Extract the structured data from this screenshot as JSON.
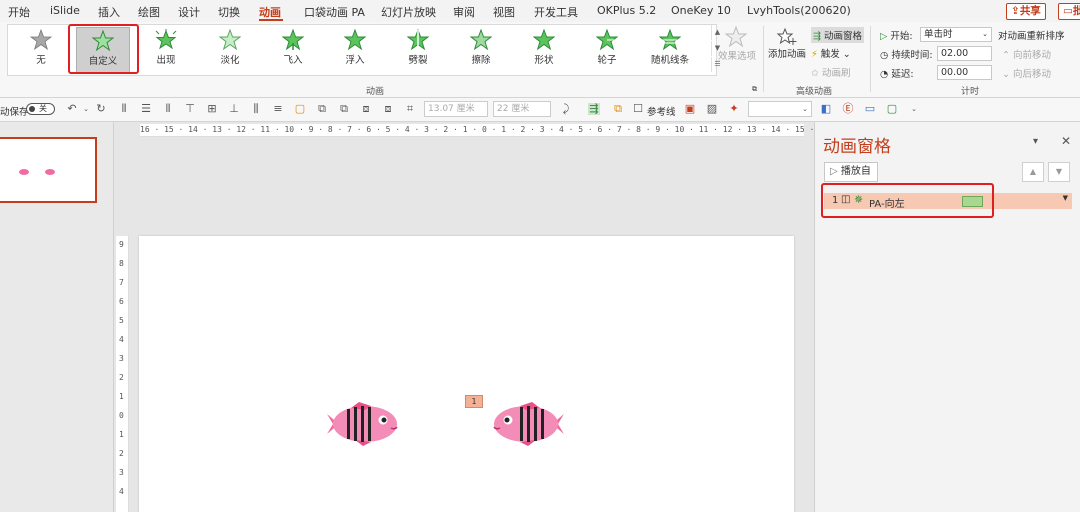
{
  "menu": {
    "tabs": [
      "开始",
      "iSlide",
      "插入",
      "绘图",
      "设计",
      "切换",
      "动画",
      "口袋动画 PA",
      "幻灯片放映",
      "审阅",
      "视图",
      "开发工具",
      "OKPlus 5.2",
      "OneKey 10",
      "LvyhTools(200620)"
    ],
    "share_label": "共享",
    "comment_label": "批"
  },
  "ribbon": {
    "animations": [
      "无",
      "自定义",
      "出现",
      "淡化",
      "飞入",
      "浮入",
      "劈裂",
      "擦除",
      "形状",
      "轮子",
      "随机线条"
    ],
    "effect_options_label": "效果选项",
    "group_animation_label": "动画",
    "add_animation_label": "添加动画",
    "animation_pane_label": "动画窗格",
    "trigger_label": "触发",
    "animation_painter_label": "动画刷",
    "group_advanced_label": "高级动画",
    "start_label": "开始:",
    "start_value": "单击时",
    "duration_label": "持续时间:",
    "duration_value": "02.00",
    "delay_label": "延迟:",
    "delay_value": "00.00",
    "reorder_label": "对动画重新排序",
    "move_earlier_label": "向前移动",
    "move_later_label": "向后移动",
    "group_timing_label": "计时"
  },
  "toolbar2": {
    "autosave_label": "动保存",
    "autosave_state": "关",
    "width_value": "13.07 厘米",
    "height_value": "22 厘米",
    "guides_label": "参考线"
  },
  "ruler": {
    "horizontal": "16 · 15 · 14 · 13 · 12 · 11 · 10 · 9 · 8 · 7 · 6 · 5 · 4 · 3 · 2 · 1 · 0 · 1 · 2 · 3 · 4 · 5 · 6 · 7 · 8 · 9 · 10 · 11 · 12 · 13 · 14 · 15 · 16",
    "vertical": [
      "9",
      "8",
      "7",
      "6",
      "5",
      "4",
      "3",
      "2",
      "1",
      "0",
      "1",
      "2",
      "3",
      "4"
    ]
  },
  "slide": {
    "animation_tag": "1"
  },
  "pane": {
    "title": "动画窗格",
    "play_from_label": "播放自",
    "items": [
      {
        "number": "1",
        "name": "PA-向左"
      }
    ]
  },
  "colors": {
    "accent": "#c43e1c",
    "highlight_box": "#e02020",
    "fish_body": "#f06ca0",
    "anim_row": "#f7c9b3",
    "timing_bar": "#a8d890"
  }
}
